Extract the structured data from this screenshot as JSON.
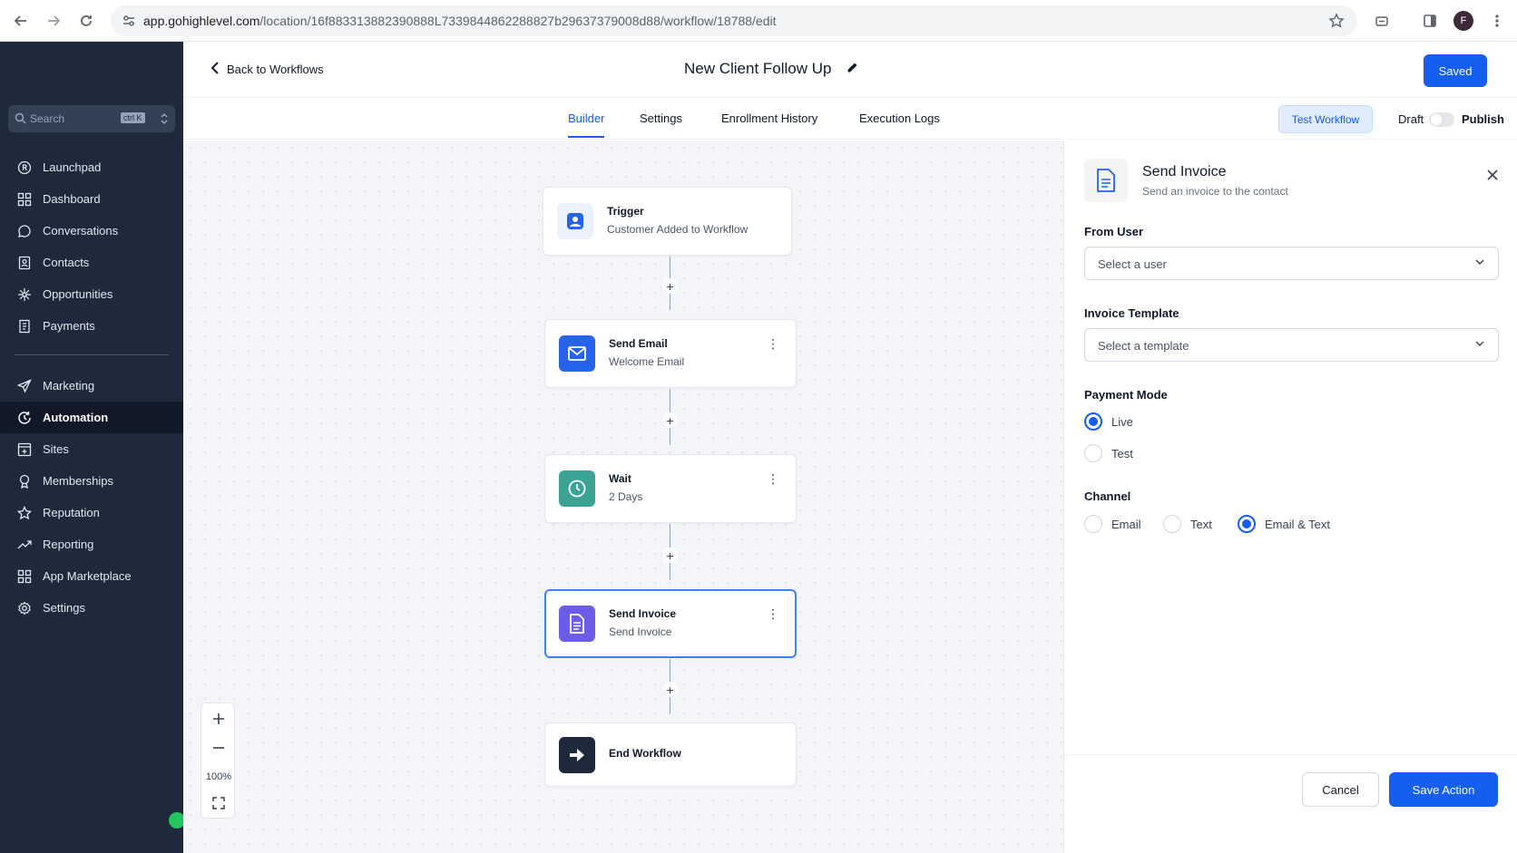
{
  "browser": {
    "url_host": "app.gohighlevel.com",
    "url_path": "/location/16f883313882390888L7339844862288827b29637379008d88/workflow/18788/edit"
  },
  "browser_profile": {
    "initial": "F"
  },
  "sidebar": {
    "search": {
      "placeholder": "Search",
      "shortcut": "ctrl K"
    },
    "items": [
      {
        "label": "Launchpad",
        "icon": "launchpad-icon"
      },
      {
        "label": "Dashboard",
        "icon": "grid-icon"
      },
      {
        "label": "Conversations",
        "icon": "chat-bubble-icon"
      },
      {
        "label": "Contacts",
        "icon": "contact-card-icon"
      },
      {
        "label": "Opportunities",
        "icon": "network-icon"
      },
      {
        "label": "Payments",
        "icon": "receipt-icon"
      },
      {
        "label": "Marketing",
        "icon": "send-icon"
      },
      {
        "label": "Automation",
        "icon": "automation-icon",
        "active": true
      },
      {
        "label": "Sites",
        "icon": "sites-icon"
      },
      {
        "label": "Memberships",
        "icon": "membership-icon"
      },
      {
        "label": "Reputation",
        "icon": "star-icon"
      },
      {
        "label": "Reporting",
        "icon": "trend-icon"
      },
      {
        "label": "App Marketplace",
        "icon": "apps-icon"
      },
      {
        "label": "Settings",
        "icon": "gear-icon"
      }
    ]
  },
  "header": {
    "back_label": "Back to Workflows",
    "workflow_title": "New Client Follow Up",
    "saved_label": "Saved"
  },
  "tabs": {
    "items": [
      "Builder",
      "Settings",
      "Enrollment History",
      "Execution Logs"
    ],
    "active": "Builder",
    "test_label": "Test Workflow",
    "draft_label": "Draft",
    "publish_label": "Publish"
  },
  "nodes": [
    {
      "title": "Trigger",
      "subtitle": "Customer Added to Workflow",
      "icon": "user-trigger-icon"
    },
    {
      "title": "Send Email",
      "subtitle": "Welcome Email",
      "icon": "mail-icon"
    },
    {
      "title": "Wait",
      "subtitle": "2 Days",
      "icon": "clock-icon"
    },
    {
      "title": "Send Invoice",
      "subtitle": "Send Invoice",
      "icon": "invoice-icon"
    },
    {
      "title": "End Workflow",
      "icon": "exit-arrow-icon"
    }
  ],
  "zoom": {
    "level": "100%"
  },
  "panel": {
    "title": "Send Invoice",
    "subtitle": "Send an invoice to the contact",
    "from_user": {
      "label": "From User",
      "value": "Select a user"
    },
    "invoice_template": {
      "label": "Invoice Template",
      "value": "Select a template"
    },
    "payment_mode": {
      "label": "Payment Mode",
      "options": [
        "Live",
        "Test"
      ],
      "selected": "Live"
    },
    "channel": {
      "label": "Channel",
      "options": [
        "Email",
        "Text",
        "Email & Text"
      ],
      "selected": "Email & Text"
    },
    "cancel_label": "Cancel",
    "save_label": "Save Action"
  },
  "colors": {
    "accent": "#155eef",
    "sidebar_bg": "#1e293b"
  }
}
